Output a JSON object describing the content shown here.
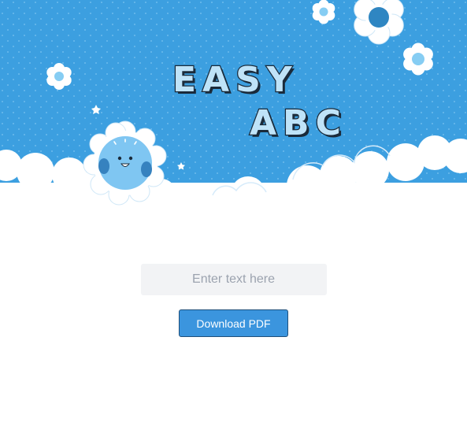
{
  "hero": {
    "title_line1": "EASY",
    "title_line2": "ABC",
    "sky_color": "#3c9fe0",
    "cloud_color": "#ffffff"
  },
  "form": {
    "text_input": {
      "placeholder": "Enter text here",
      "value": ""
    },
    "download_label": "Download PDF",
    "button_color": "#3b95de"
  }
}
